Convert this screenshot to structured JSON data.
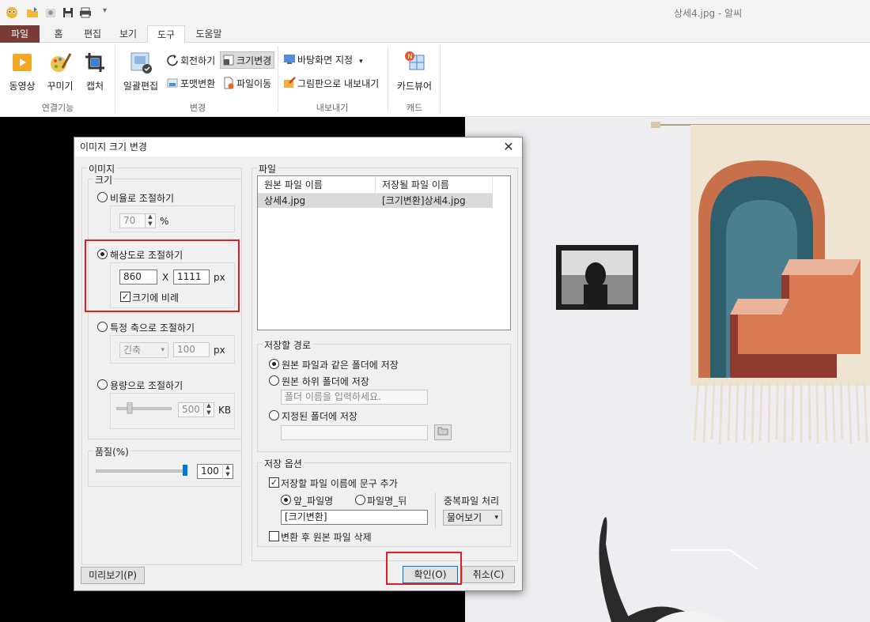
{
  "window": {
    "title": "상세4.jpg - 알씨"
  },
  "menu_tabs": [
    "파일",
    "홈",
    "편집",
    "보기",
    "도구",
    "도움말"
  ],
  "ribbon": {
    "connect": {
      "video": "동영상",
      "decorate": "꾸미기",
      "capture": "캡처",
      "group": "연결기능"
    },
    "convert": {
      "batch_edit": "일괄편집",
      "rotate": "회전하기",
      "resize": "크기변경",
      "format": "포맷변환",
      "move": "파일이동",
      "group": "변경"
    },
    "export": {
      "wallpaper": "바탕화면 지정",
      "paint": "그림판으로 내보내기",
      "group": "내보내기"
    },
    "card": {
      "viewer": "카드뷰어",
      "group": "캐드"
    }
  },
  "dialog": {
    "title": "이미지 크기 변경",
    "image_group": "이미지",
    "size_group": "크기",
    "ratio": {
      "label": "비율로 조절하기",
      "value": "70",
      "unit": "%"
    },
    "resolution": {
      "label": "해상도로 조절하기",
      "width": "860",
      "x": "X",
      "height": "1111",
      "unit": "px",
      "keep_ratio": "크기에 비례"
    },
    "axis": {
      "label": "특정 축으로 조절하기",
      "axis_value": "긴축",
      "value": "100",
      "unit": "px"
    },
    "capacity": {
      "label": "용량으로 조절하기",
      "value": "500",
      "unit": "KB"
    },
    "quality": {
      "label": "품질(%)",
      "value": "100"
    },
    "preview_button": "미리보기(P)",
    "file_group": "파일",
    "file_list": {
      "headers": [
        "원본 파일 이름",
        "저장될 파일 이름"
      ],
      "rows": [
        {
          "original": "상세4.jpg",
          "saved": "[크기변환]상세4.jpg"
        }
      ]
    },
    "save_path": {
      "title": "저장할 경로",
      "same_folder": "원본 파일과 같은 폴더에 저장",
      "sub_folder": "원본 하위 폴더에 저장",
      "sub_folder_placeholder": "폴더 이름을 입력하세요.",
      "specified_folder": "지정된 폴더에 저장"
    },
    "save_options": {
      "title": "저장 옵션",
      "add_text": "저장할 파일 이름에 문구 추가",
      "prefix": "앞_파일명",
      "suffix": "파일명_뒤",
      "text_value": "[크기변환]",
      "duplicate_label": "중복파일 처리",
      "duplicate_value": "물어보기",
      "delete_original": "변환 후 원본 파일 삭제"
    },
    "ok_button": "확인(O)",
    "cancel_button": "취소(C)"
  }
}
